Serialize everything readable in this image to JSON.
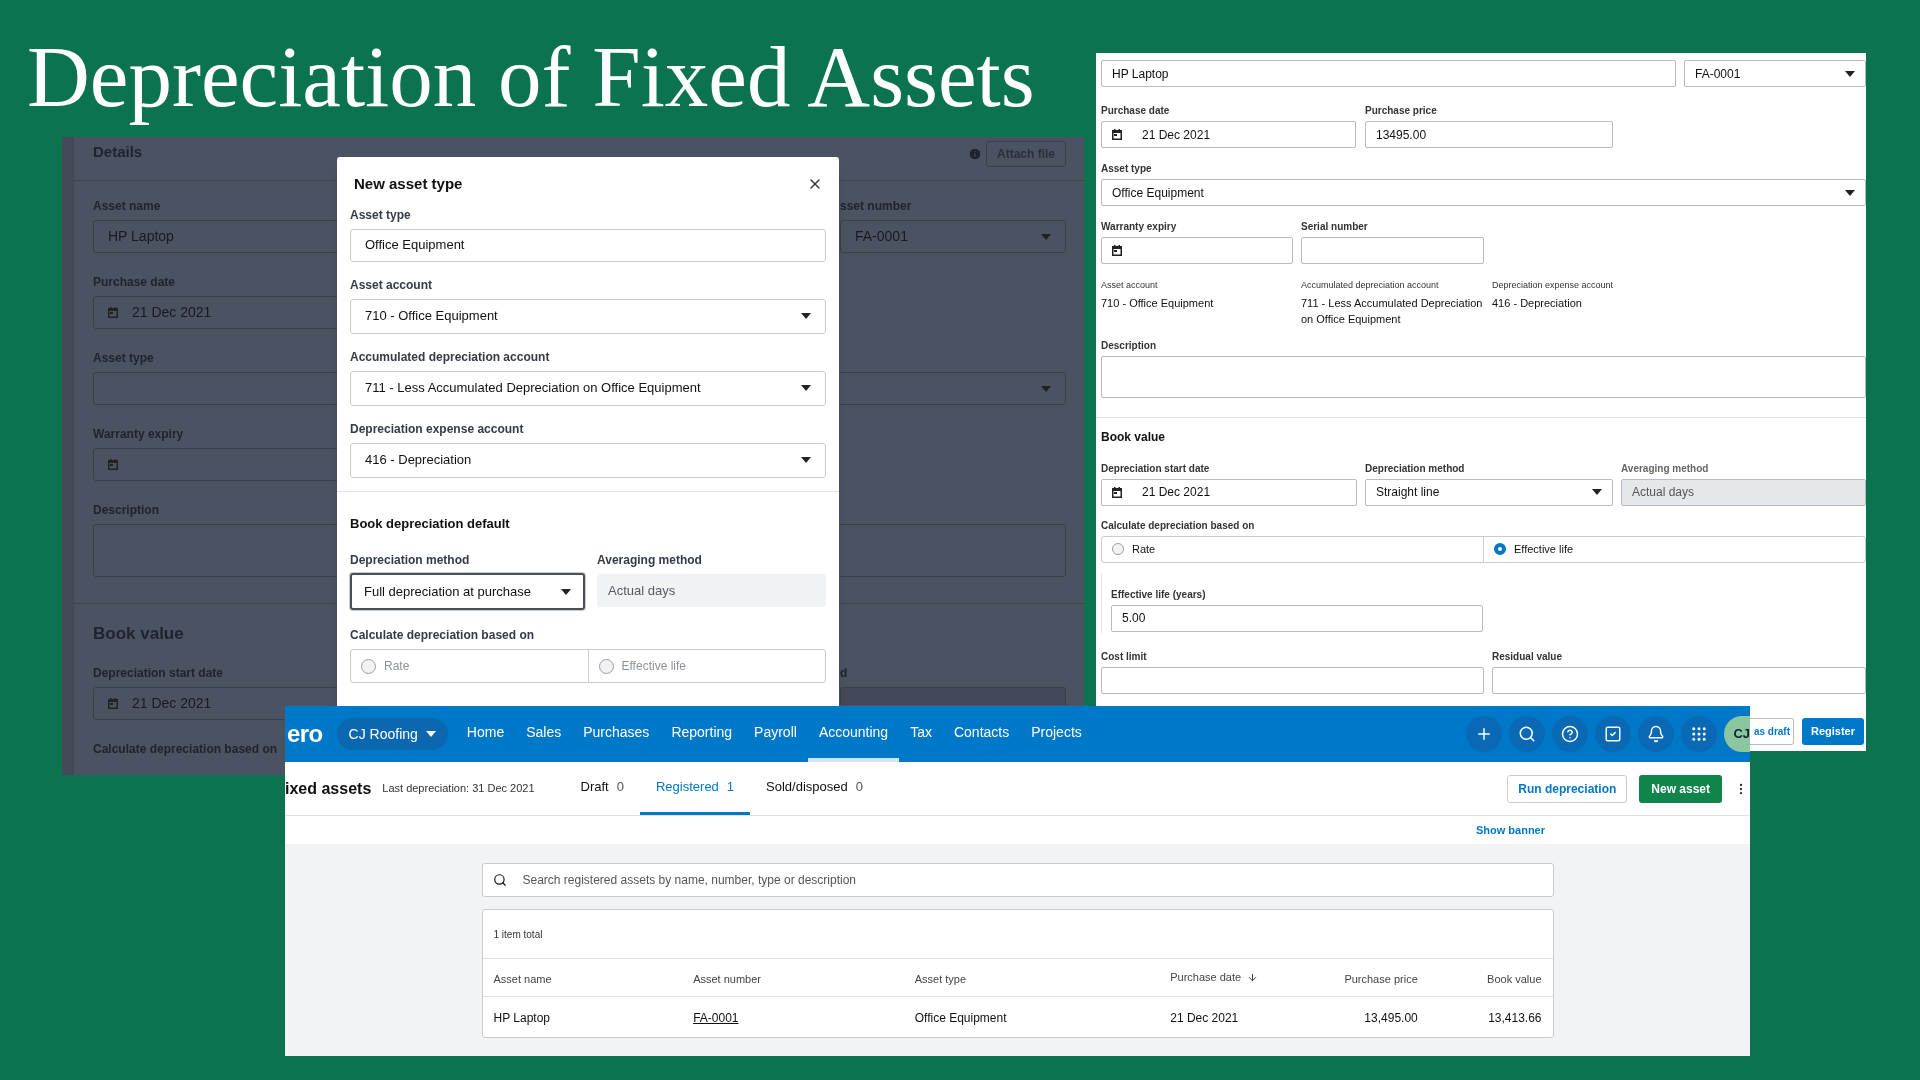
{
  "title": "Depreciation of Fixed Assets",
  "details_form": {
    "heading": "Details",
    "attach_button": "Attach file",
    "asset_name": {
      "label": "Asset name",
      "value": "HP Laptop"
    },
    "asset_number": {
      "label": "sset number",
      "value": "FA-0001"
    },
    "purchase_date": {
      "label": "Purchase date",
      "value": "21 Dec 2021"
    },
    "asset_type": {
      "label": "Asset type"
    },
    "warranty_expiry": {
      "label": "Warranty expiry"
    },
    "description": {
      "label": "Description"
    },
    "book_value_heading": "Book value",
    "start_date": {
      "label": "Depreciation start date",
      "value": "21 Dec 2021"
    },
    "averaging_label": "d",
    "calculate_label": "Calculate depreciation based on"
  },
  "modal": {
    "title": "New asset type",
    "fields": [
      {
        "kind": "text",
        "label": "Asset type",
        "value": "Office Equipment"
      },
      {
        "kind": "select",
        "label": "Asset account",
        "value": "710 - Office Equipment"
      },
      {
        "kind": "select",
        "label": "Accumulated depreciation account",
        "value": "711 - Less Accumulated Depreciation on Office Equipment"
      },
      {
        "kind": "select",
        "label": "Depreciation expense account",
        "value": "416 - Depreciation"
      }
    ],
    "section_title": "Book depreciation default",
    "depreciation_method": {
      "label": "Depreciation method",
      "value": "Full depreciation at purchase",
      "focused": true
    },
    "averaging_method": {
      "label": "Averaging method",
      "value": "Actual days"
    },
    "calculate": {
      "label": "Calculate depreciation based on",
      "options": [
        {
          "label": "Rate",
          "selected": false
        },
        {
          "label": "Effective life",
          "selected": false
        }
      ]
    }
  },
  "asset_form": {
    "asset_name": {
      "value": "HP Laptop"
    },
    "asset_number": {
      "value": "FA-0001"
    },
    "purchase_date": {
      "label": "Purchase date",
      "value": "21 Dec 2021"
    },
    "purchase_price": {
      "label": "Purchase price",
      "value": "13495.00"
    },
    "asset_type": {
      "label": "Asset type",
      "value": "Office Equipment"
    },
    "warranty_expiry": {
      "label": "Warranty expiry"
    },
    "serial_number": {
      "label": "Serial number"
    },
    "accounts": [
      {
        "label": "Asset account",
        "value": "710 - Office Equipment"
      },
      {
        "label": "Accumulated depreciation account",
        "value": "711 - Less Accumulated Depreciation on Office Equipment"
      },
      {
        "label": "Depreciation expense account",
        "value": "416 - Depreciation"
      }
    ],
    "description": {
      "label": "Description"
    },
    "book_value_heading": "Book value",
    "start_date": {
      "label": "Depreciation start date",
      "value": "21 Dec 2021"
    },
    "depreciation_method": {
      "label": "Depreciation method",
      "value": "Straight line"
    },
    "averaging_method": {
      "label": "Averaging method",
      "value": "Actual days"
    },
    "calculate": {
      "label": "Calculate depreciation based on",
      "options": [
        {
          "label": "Rate",
          "selected": false
        },
        {
          "label": "Effective life",
          "selected": true
        }
      ]
    },
    "effective_life": {
      "label": "Effective life (years)",
      "value": "5.00"
    },
    "cost_limit": {
      "label": "Cost limit"
    },
    "residual_value": {
      "label": "Residual value"
    },
    "buttons": [
      "as draft",
      "Register"
    ]
  },
  "app": {
    "logo": "ero",
    "organisation": "CJ Roofing",
    "nav": [
      {
        "label": "Home",
        "selected": false
      },
      {
        "label": "Sales",
        "selected": false
      },
      {
        "label": "Purchases",
        "selected": false
      },
      {
        "label": "Reporting",
        "selected": false
      },
      {
        "label": "Payroll",
        "selected": false
      },
      {
        "label": "Accounting",
        "selected": true
      },
      {
        "label": "Tax",
        "selected": false
      },
      {
        "label": "Contacts",
        "selected": false
      },
      {
        "label": "Projects",
        "selected": false
      }
    ],
    "avatar": "CJ",
    "page_title": "ixed assets",
    "last_depreciation": "Last depreciation: 31 Dec 2021",
    "tabs": [
      {
        "label": "Draft",
        "count": "0",
        "selected": false
      },
      {
        "label": "Registered",
        "count": "1",
        "selected": true
      },
      {
        "label": "Sold/disposed",
        "count": "0",
        "selected": false
      }
    ],
    "buttons": [
      "Run depreciation",
      "New asset"
    ],
    "show_banner": "Show banner",
    "search": {
      "placeholder": "Search registered assets by name, number, type or description"
    },
    "table": {
      "summary": "1 item total",
      "columns": [
        "Asset name",
        "Asset number",
        "Asset type",
        "Purchase date",
        "Purchase price",
        "Book value"
      ],
      "rows": [
        [
          "HP Laptop",
          "FA-0001",
          "Office Equipment",
          "21 Dec 2021",
          "13,495.00",
          "13,413.66"
        ]
      ]
    }
  }
}
